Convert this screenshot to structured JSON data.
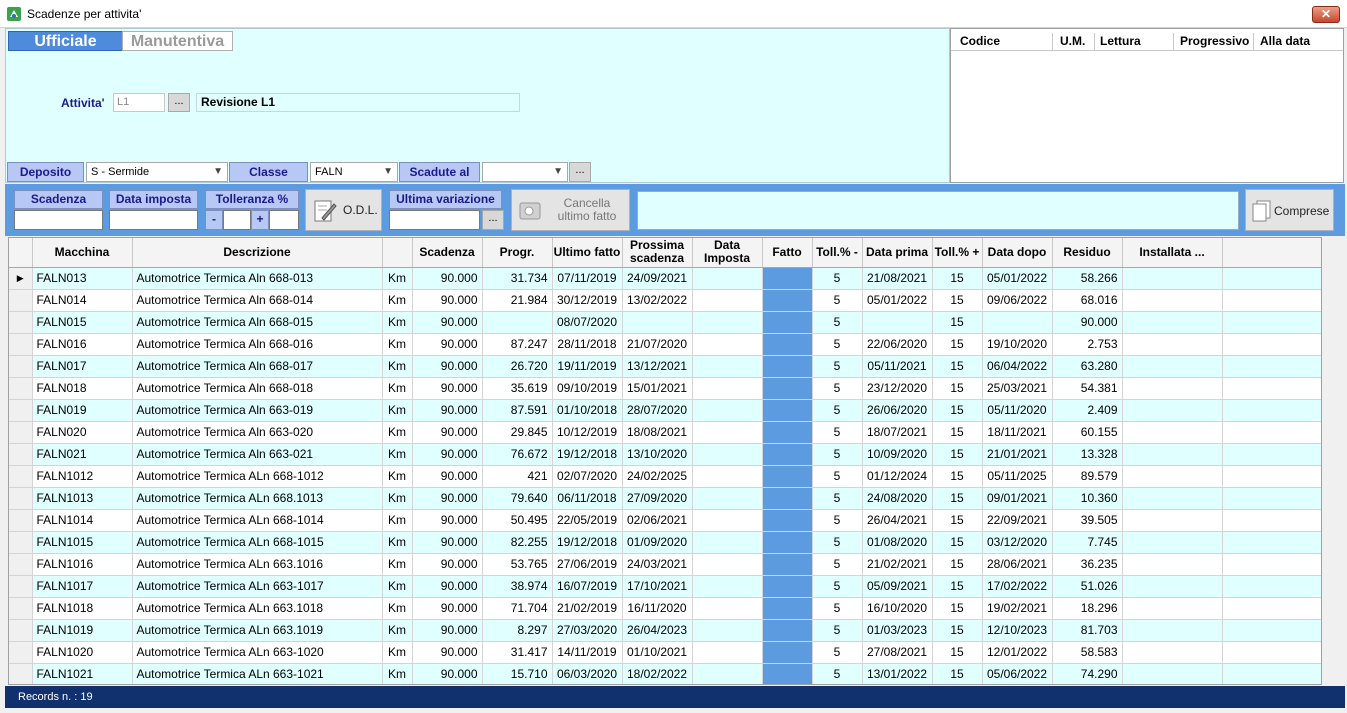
{
  "window": {
    "title": "Scadenze per attivita'",
    "close_label": "✕"
  },
  "tabs": {
    "active": "Ufficiale",
    "inactive": "Manutentiva"
  },
  "attivita": {
    "label": "Attivita'",
    "code": "L1",
    "browse": "...",
    "description": "Revisione L1"
  },
  "filters": {
    "deposito_label": "Deposito",
    "deposito_value": "S - Sermide",
    "classe_label": "Classe",
    "classe_value": "FALN",
    "scadute_label": "Scadute al",
    "scadute_value": "",
    "scadute_browse": "..."
  },
  "right_panel": {
    "headers": [
      "Codice",
      "U.M.",
      "Lettura",
      "Progressivo",
      "Alla data"
    ]
  },
  "toolbar": {
    "scadenza_label": "Scadenza",
    "data_imposta_label": "Data imposta",
    "tolleranza_label": "Tolleranza %",
    "minus": "-",
    "plus": "+",
    "odl_label": "O.D.L.",
    "ultima_variazione_label": "Ultima variazione",
    "ultima_browse": "...",
    "cancella_label": "Cancella ultimo fatto",
    "comprese_label": "Comprese"
  },
  "table": {
    "headers": [
      "Macchina",
      "Descrizione",
      "",
      "Scadenza",
      "Progr.",
      "Ultimo fatto",
      "Prossima scadenza",
      "Data Imposta",
      "Fatto",
      "Toll.% -",
      "Data prima",
      "Toll.% +",
      "Data dopo",
      "Residuo",
      "Installata ..."
    ],
    "rows": [
      [
        "FALN013",
        "Automotrice Termica Aln 668-013",
        "Km",
        "90.000",
        "31.734",
        "07/11/2019",
        "24/09/2021",
        "",
        "",
        "5",
        "21/08/2021",
        "15",
        "05/01/2022",
        "58.266",
        ""
      ],
      [
        "FALN014",
        "Automotrice Termica Aln 668-014",
        "Km",
        "90.000",
        "21.984",
        "30/12/2019",
        "13/02/2022",
        "",
        "",
        "5",
        "05/01/2022",
        "15",
        "09/06/2022",
        "68.016",
        ""
      ],
      [
        "FALN015",
        "Automotrice Termica Aln 668-015",
        "Km",
        "90.000",
        "",
        "08/07/2020",
        "",
        "",
        "",
        "5",
        "",
        "15",
        "",
        "90.000",
        ""
      ],
      [
        "FALN016",
        "Automotrice Termica Aln 668-016",
        "Km",
        "90.000",
        "87.247",
        "28/11/2018",
        "21/07/2020",
        "",
        "",
        "5",
        "22/06/2020",
        "15",
        "19/10/2020",
        "2.753",
        ""
      ],
      [
        "FALN017",
        "Automotrice Termica Aln 668-017",
        "Km",
        "90.000",
        "26.720",
        "19/11/2019",
        "13/12/2021",
        "",
        "",
        "5",
        "05/11/2021",
        "15",
        "06/04/2022",
        "63.280",
        ""
      ],
      [
        "FALN018",
        "Automotrice Termica Aln 668-018",
        "Km",
        "90.000",
        "35.619",
        "09/10/2019",
        "15/01/2021",
        "",
        "",
        "5",
        "23/12/2020",
        "15",
        "25/03/2021",
        "54.381",
        ""
      ],
      [
        "FALN019",
        "Automotrice Termica Aln 663-019",
        "Km",
        "90.000",
        "87.591",
        "01/10/2018",
        "28/07/2020",
        "",
        "",
        "5",
        "26/06/2020",
        "15",
        "05/11/2020",
        "2.409",
        ""
      ],
      [
        "FALN020",
        "Automotrice Termica Aln 663-020",
        "Km",
        "90.000",
        "29.845",
        "10/12/2019",
        "18/08/2021",
        "",
        "",
        "5",
        "18/07/2021",
        "15",
        "18/11/2021",
        "60.155",
        ""
      ],
      [
        "FALN021",
        "Automotrice Termica Aln 663-021",
        "Km",
        "90.000",
        "76.672",
        "19/12/2018",
        "13/10/2020",
        "",
        "",
        "5",
        "10/09/2020",
        "15",
        "21/01/2021",
        "13.328",
        ""
      ],
      [
        "FALN1012",
        "Automotrice Termica ALn 668-1012",
        "Km",
        "90.000",
        "421",
        "02/07/2020",
        "24/02/2025",
        "",
        "",
        "5",
        "01/12/2024",
        "15",
        "05/11/2025",
        "89.579",
        ""
      ],
      [
        "FALN1013",
        "Automotrice Termica ALn 668.1013",
        "Km",
        "90.000",
        "79.640",
        "06/11/2018",
        "27/09/2020",
        "",
        "",
        "5",
        "24/08/2020",
        "15",
        "09/01/2021",
        "10.360",
        ""
      ],
      [
        "FALN1014",
        "Automotrice Termica ALn 668-1014",
        "Km",
        "90.000",
        "50.495",
        "22/05/2019",
        "02/06/2021",
        "",
        "",
        "5",
        "26/04/2021",
        "15",
        "22/09/2021",
        "39.505",
        ""
      ],
      [
        "FALN1015",
        "Automotrice Termica ALn 668-1015",
        "Km",
        "90.000",
        "82.255",
        "19/12/2018",
        "01/09/2020",
        "",
        "",
        "5",
        "01/08/2020",
        "15",
        "03/12/2020",
        "7.745",
        ""
      ],
      [
        "FALN1016",
        "Automotrice Termica ALn 663.1016",
        "Km",
        "90.000",
        "53.765",
        "27/06/2019",
        "24/03/2021",
        "",
        "",
        "5",
        "21/02/2021",
        "15",
        "28/06/2021",
        "36.235",
        ""
      ],
      [
        "FALN1017",
        "Automotrice Termica ALn 663-1017",
        "Km",
        "90.000",
        "38.974",
        "16/07/2019",
        "17/10/2021",
        "",
        "",
        "5",
        "05/09/2021",
        "15",
        "17/02/2022",
        "51.026",
        ""
      ],
      [
        "FALN1018",
        "Automotrice Termica ALn 663.1018",
        "Km",
        "90.000",
        "71.704",
        "21/02/2019",
        "16/11/2020",
        "",
        "",
        "5",
        "16/10/2020",
        "15",
        "19/02/2021",
        "18.296",
        ""
      ],
      [
        "FALN1019",
        "Automotrice Termica ALn 663.1019",
        "Km",
        "90.000",
        "8.297",
        "27/03/2020",
        "26/04/2023",
        "",
        "",
        "5",
        "01/03/2023",
        "15",
        "12/10/2023",
        "81.703",
        ""
      ],
      [
        "FALN1020",
        "Automotrice Termica ALn 663-1020",
        "Km",
        "90.000",
        "31.417",
        "14/11/2019",
        "01/10/2021",
        "",
        "",
        "5",
        "27/08/2021",
        "15",
        "12/01/2022",
        "58.583",
        ""
      ],
      [
        "FALN1021",
        "Automotrice Termica ALn 663-1021",
        "Km",
        "90.000",
        "15.710",
        "06/03/2020",
        "18/02/2022",
        "",
        "",
        "5",
        "13/01/2022",
        "15",
        "05/06/2022",
        "74.290",
        ""
      ]
    ]
  },
  "status": {
    "records": "Records n. : 19"
  },
  "colors": {
    "accent": "#5d9be0",
    "panel": "#e0ffff",
    "label_bg": "#b8c8f4",
    "status_bg": "#11306e"
  }
}
